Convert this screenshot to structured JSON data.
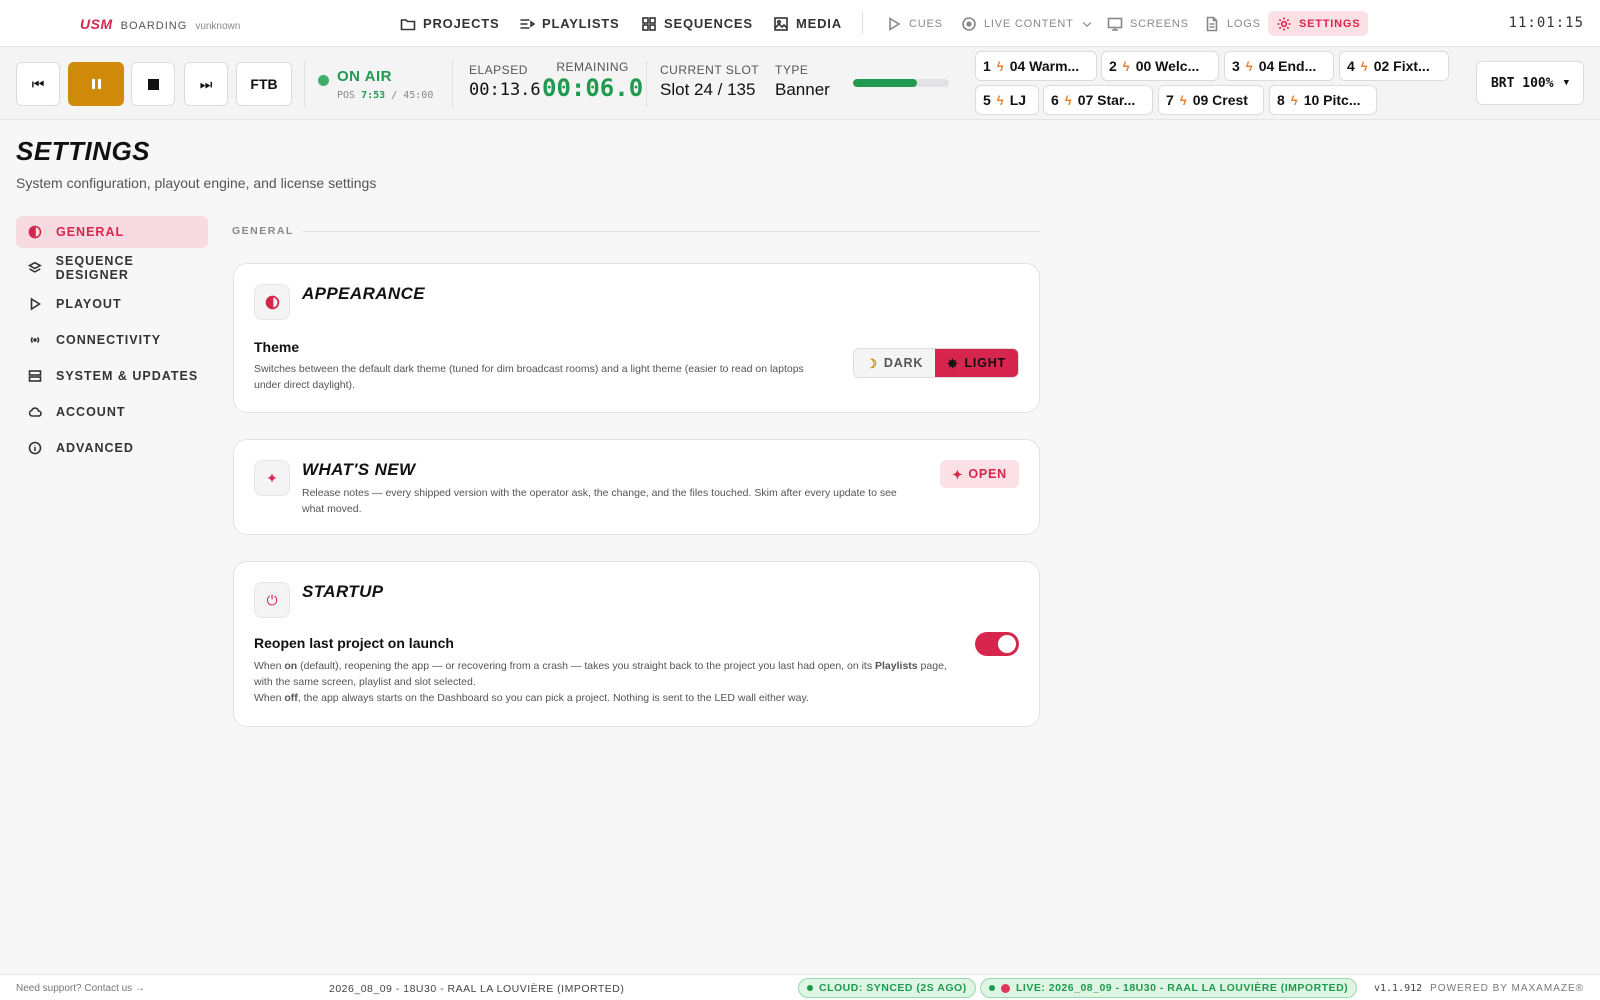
{
  "brand": {
    "logo": "USM",
    "project": "BOARDING",
    "user": "vunknown"
  },
  "nav": {
    "main": [
      {
        "label": "PROJECTS",
        "icon": "folder-icon"
      },
      {
        "label": "PLAYLISTS",
        "icon": "playlist-icon"
      },
      {
        "label": "SEQUENCES",
        "icon": "grid-icon"
      },
      {
        "label": "MEDIA",
        "icon": "image-icon"
      }
    ],
    "secondary": [
      {
        "label": "CUES",
        "icon": "play-icon"
      },
      {
        "label": "LIVE CONTENT",
        "icon": "record-icon"
      },
      {
        "label": "SCREENS",
        "icon": "monitor-icon"
      },
      {
        "label": "LOGS",
        "icon": "document-icon"
      },
      {
        "label": "SETTINGS",
        "icon": "gear-icon"
      }
    ],
    "active": "SETTINGS"
  },
  "clock": "11:01:15",
  "transport": {
    "ftb": "FTB",
    "status": "ON AIR",
    "pos_label": "POS",
    "pos": "7:53",
    "duration": "45:00",
    "elapsed_label": "ELAPSED",
    "elapsed": "00:13.6",
    "remaining_label": "REMAINING",
    "remaining": "00:06.0",
    "slot_label": "CURRENT SLOT",
    "slot": "Slot 24 / 135",
    "type_label": "TYPE",
    "type": "Banner",
    "progress": 0.67,
    "brightness": "BRT 100%"
  },
  "cues": [
    {
      "num": "1",
      "label": "04 Warm..."
    },
    {
      "num": "2",
      "label": "00 Welc..."
    },
    {
      "num": "3",
      "label": "04 End..."
    },
    {
      "num": "4",
      "label": "02 Fixt..."
    },
    {
      "num": "5",
      "label": "LJ"
    },
    {
      "num": "6",
      "label": "07 Star..."
    },
    {
      "num": "7",
      "label": "09 Crest"
    },
    {
      "num": "8",
      "label": "10 Pitc..."
    }
  ],
  "page": {
    "title": "SETTINGS",
    "subtitle": "System configuration, playout engine, and license settings",
    "section": "GENERAL"
  },
  "sidebar": [
    {
      "label": "GENERAL",
      "icon": "contrast-icon"
    },
    {
      "label": "SEQUENCE DESIGNER",
      "icon": "layers-icon"
    },
    {
      "label": "PLAYOUT",
      "icon": "play-icon"
    },
    {
      "label": "CONNECTIVITY",
      "icon": "broadcast-icon"
    },
    {
      "label": "SYSTEM & UPDATES",
      "icon": "server-icon"
    },
    {
      "label": "ACCOUNT",
      "icon": "cloud-icon"
    },
    {
      "label": "ADVANCED",
      "icon": "info-icon"
    }
  ],
  "cards": {
    "appearance": {
      "title": "APPEARANCE",
      "row_title": "Theme",
      "row_desc_1": "Switches between the default dark theme (tuned for dim broadcast rooms) and a light theme (easier to read on laptops",
      "row_desc_2": "under direct daylight).",
      "dark": "DARK",
      "light": "LIGHT",
      "selected": "LIGHT"
    },
    "whatsnew": {
      "title": "WHAT'S NEW",
      "desc_1": "Release notes — every shipped version with the operator ask, the change, and the files touched. Skim after every update to see",
      "desc_2": "what moved.",
      "button": "OPEN"
    },
    "startup": {
      "title": "STARTUP",
      "row_title": "Reopen last project on launch",
      "desc_1a": "When ",
      "desc_1b": "on",
      "desc_1c": " (default), reopening the app — or recovering from a crash — takes you straight back to the project you last had open, on its ",
      "desc_1d": "Playlists",
      "desc_1e": " page,",
      "desc_2": "with the same screen, playlist and slot selected.",
      "desc_3a": "When ",
      "desc_3b": "off",
      "desc_3c": ", the app always starts on the Dashboard so you can pick a project. Nothing is sent to the LED wall either way.",
      "toggle_on": true
    }
  },
  "footer": {
    "support": "Need support? Contact us →",
    "project": "2026_08_09 - 18U30 - RAAL LA LOUVIÈRE (IMPORTED)",
    "cloud": "CLOUD: SYNCED (2S AGO)",
    "live": "LIVE: 2026_08_09 - 18U30 - RAAL LA LOUVIÈRE (IMPORTED)",
    "version": "v1.1.912",
    "powered": "POWERED BY MAXAMAZE®"
  },
  "colors": {
    "accent": "#d7264d",
    "onair": "#1f9a4e",
    "pause": "#d08a0a"
  }
}
